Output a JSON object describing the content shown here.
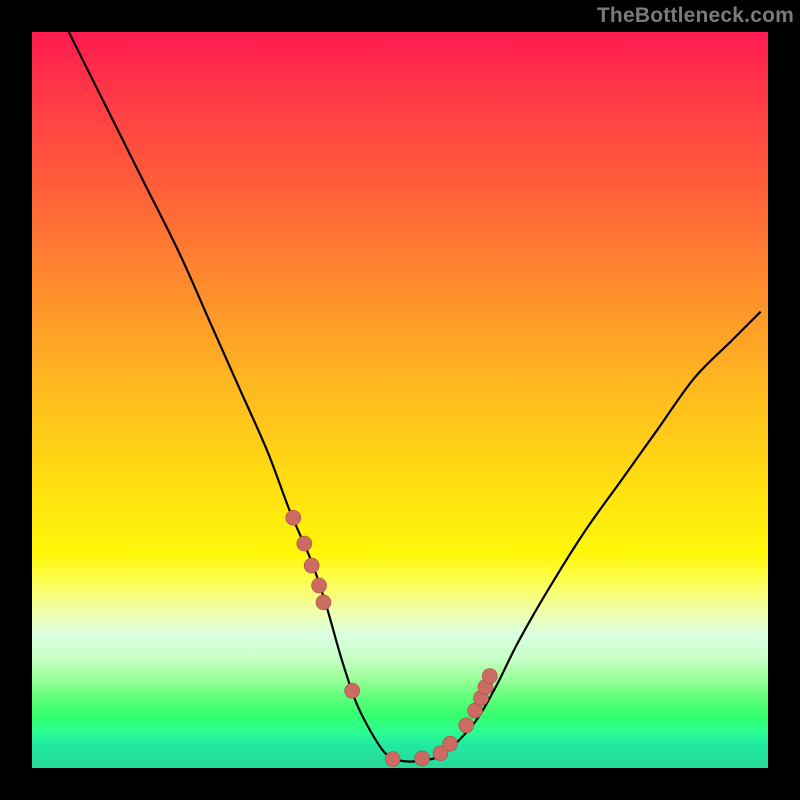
{
  "watermark": "TheBottleneck.com",
  "colors": {
    "background": "#000000",
    "curve": "#000000",
    "marker_fill": "#cc6b63",
    "marker_stroke": "#b04a42"
  },
  "chart_data": {
    "type": "line",
    "title": "",
    "xlabel": "",
    "ylabel": "",
    "xlim": [
      0,
      100
    ],
    "ylim": [
      0,
      100
    ],
    "grid": false,
    "legend": false,
    "series": [
      {
        "name": "curve",
        "x": [
          5,
          10,
          15,
          20,
          24,
          28,
          32,
          35,
          38,
          40,
          42,
          44,
          46,
          48,
          50,
          53,
          56,
          60,
          63,
          66,
          70,
          75,
          80,
          85,
          90,
          95,
          99
        ],
        "y": [
          100,
          90,
          80,
          70,
          61,
          52,
          43,
          35,
          28,
          22,
          15,
          9,
          5,
          2,
          1,
          1,
          2,
          6,
          11,
          17,
          24,
          32,
          39,
          46,
          53,
          58,
          62
        ]
      }
    ],
    "markers": {
      "name": "highlight-points",
      "x": [
        35.5,
        37.0,
        38.0,
        39.0,
        39.6,
        43.5,
        49.0,
        53.0,
        55.5,
        56.8,
        59.0,
        60.2,
        61.0,
        61.6,
        62.2
      ],
      "y": [
        34.0,
        30.5,
        27.5,
        24.8,
        22.5,
        10.5,
        1.2,
        1.3,
        2.0,
        3.3,
        5.8,
        7.8,
        9.5,
        11.0,
        12.5
      ]
    }
  }
}
